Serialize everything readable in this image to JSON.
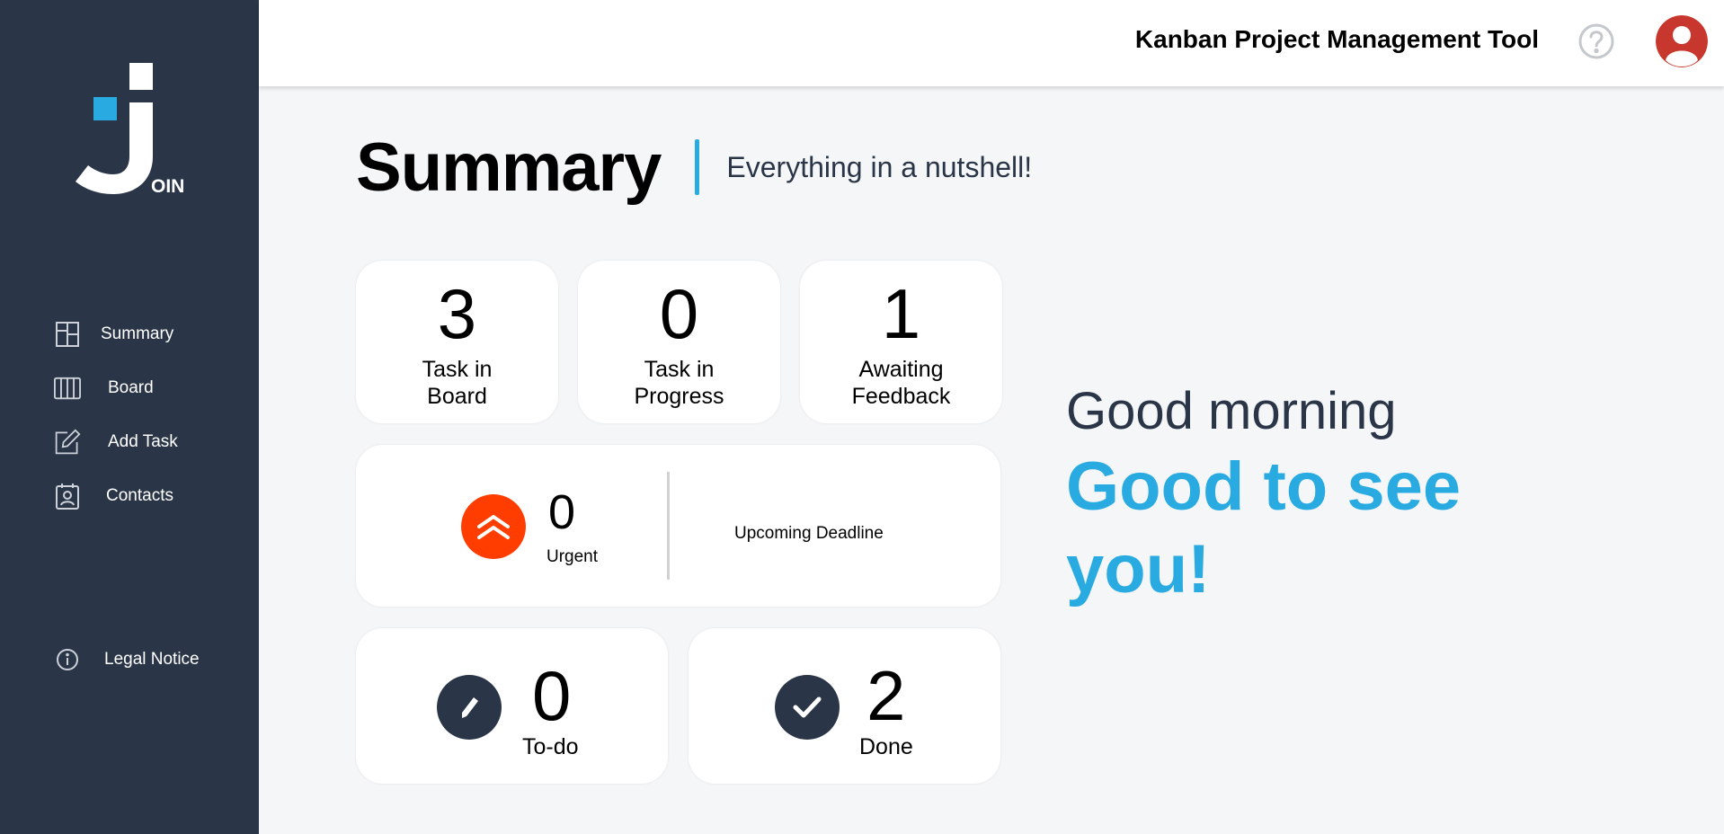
{
  "app": {
    "logo_text": "OIN"
  },
  "header": {
    "title": "Kanban Project Management Tool"
  },
  "sidebar": {
    "items": [
      {
        "label": "Summary",
        "icon": "summary-icon"
      },
      {
        "label": "Board",
        "icon": "board-icon"
      },
      {
        "label": "Add Task",
        "icon": "add-task-icon"
      },
      {
        "label": "Contacts",
        "icon": "contacts-icon"
      }
    ],
    "legal": {
      "label": "Legal Notice",
      "icon": "info-icon"
    }
  },
  "main": {
    "title": "Summary",
    "subtitle": "Everything in a nutshell!",
    "stats": [
      {
        "value": "3",
        "label_line1": "Task in",
        "label_line2": "Board"
      },
      {
        "value": "0",
        "label_line1": "Task in",
        "label_line2": "Progress"
      },
      {
        "value": "1",
        "label_line1": "Awaiting",
        "label_line2": "Feedback"
      }
    ],
    "urgent": {
      "value": "0",
      "label": "Urgent",
      "deadline_label": "Upcoming Deadline"
    },
    "todo": {
      "value": "0",
      "label": "To-do"
    },
    "done": {
      "value": "2",
      "label": "Done"
    }
  },
  "greeting": {
    "line1": "Good morning",
    "line2": "Good to see you!"
  },
  "colors": {
    "sidebar": "#2a3647",
    "accent": "#29abe2",
    "urgent": "#ff3d00",
    "avatar": "#c8372d"
  }
}
